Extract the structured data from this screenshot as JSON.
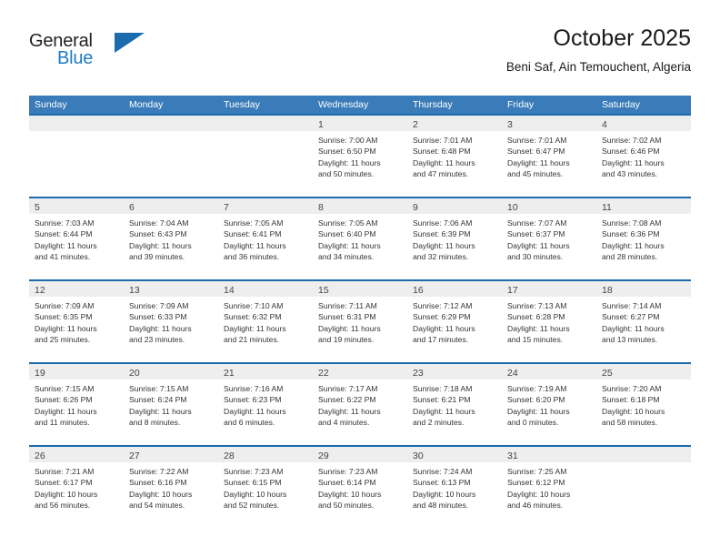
{
  "logo": {
    "word_one": "General",
    "word_two": "Blue",
    "triangle_icon": "triangle-icon",
    "accent_color": "#1a6cae"
  },
  "header": {
    "title": "October 2025",
    "subtitle": "Beni Saf, Ain Temouchent, Algeria"
  },
  "calendar": {
    "header_bg": "#3a7cba",
    "row_border_color": "#1a6cae",
    "daynum_band_color": "#eeeeee",
    "weekdays": [
      "Sunday",
      "Monday",
      "Tuesday",
      "Wednesday",
      "Thursday",
      "Friday",
      "Saturday"
    ],
    "weeks": [
      [
        {
          "day": "",
          "lines": []
        },
        {
          "day": "",
          "lines": []
        },
        {
          "day": "",
          "lines": []
        },
        {
          "day": "1",
          "lines": [
            "Sunrise: 7:00 AM",
            "Sunset: 6:50 PM",
            "Daylight: 11 hours",
            "and 50 minutes."
          ]
        },
        {
          "day": "2",
          "lines": [
            "Sunrise: 7:01 AM",
            "Sunset: 6:48 PM",
            "Daylight: 11 hours",
            "and 47 minutes."
          ]
        },
        {
          "day": "3",
          "lines": [
            "Sunrise: 7:01 AM",
            "Sunset: 6:47 PM",
            "Daylight: 11 hours",
            "and 45 minutes."
          ]
        },
        {
          "day": "4",
          "lines": [
            "Sunrise: 7:02 AM",
            "Sunset: 6:46 PM",
            "Daylight: 11 hours",
            "and 43 minutes."
          ]
        }
      ],
      [
        {
          "day": "5",
          "lines": [
            "Sunrise: 7:03 AM",
            "Sunset: 6:44 PM",
            "Daylight: 11 hours",
            "and 41 minutes."
          ]
        },
        {
          "day": "6",
          "lines": [
            "Sunrise: 7:04 AM",
            "Sunset: 6:43 PM",
            "Daylight: 11 hours",
            "and 39 minutes."
          ]
        },
        {
          "day": "7",
          "lines": [
            "Sunrise: 7:05 AM",
            "Sunset: 6:41 PM",
            "Daylight: 11 hours",
            "and 36 minutes."
          ]
        },
        {
          "day": "8",
          "lines": [
            "Sunrise: 7:05 AM",
            "Sunset: 6:40 PM",
            "Daylight: 11 hours",
            "and 34 minutes."
          ]
        },
        {
          "day": "9",
          "lines": [
            "Sunrise: 7:06 AM",
            "Sunset: 6:39 PM",
            "Daylight: 11 hours",
            "and 32 minutes."
          ]
        },
        {
          "day": "10",
          "lines": [
            "Sunrise: 7:07 AM",
            "Sunset: 6:37 PM",
            "Daylight: 11 hours",
            "and 30 minutes."
          ]
        },
        {
          "day": "11",
          "lines": [
            "Sunrise: 7:08 AM",
            "Sunset: 6:36 PM",
            "Daylight: 11 hours",
            "and 28 minutes."
          ]
        }
      ],
      [
        {
          "day": "12",
          "lines": [
            "Sunrise: 7:09 AM",
            "Sunset: 6:35 PM",
            "Daylight: 11 hours",
            "and 25 minutes."
          ]
        },
        {
          "day": "13",
          "lines": [
            "Sunrise: 7:09 AM",
            "Sunset: 6:33 PM",
            "Daylight: 11 hours",
            "and 23 minutes."
          ]
        },
        {
          "day": "14",
          "lines": [
            "Sunrise: 7:10 AM",
            "Sunset: 6:32 PM",
            "Daylight: 11 hours",
            "and 21 minutes."
          ]
        },
        {
          "day": "15",
          "lines": [
            "Sunrise: 7:11 AM",
            "Sunset: 6:31 PM",
            "Daylight: 11 hours",
            "and 19 minutes."
          ]
        },
        {
          "day": "16",
          "lines": [
            "Sunrise: 7:12 AM",
            "Sunset: 6:29 PM",
            "Daylight: 11 hours",
            "and 17 minutes."
          ]
        },
        {
          "day": "17",
          "lines": [
            "Sunrise: 7:13 AM",
            "Sunset: 6:28 PM",
            "Daylight: 11 hours",
            "and 15 minutes."
          ]
        },
        {
          "day": "18",
          "lines": [
            "Sunrise: 7:14 AM",
            "Sunset: 6:27 PM",
            "Daylight: 11 hours",
            "and 13 minutes."
          ]
        }
      ],
      [
        {
          "day": "19",
          "lines": [
            "Sunrise: 7:15 AM",
            "Sunset: 6:26 PM",
            "Daylight: 11 hours",
            "and 11 minutes."
          ]
        },
        {
          "day": "20",
          "lines": [
            "Sunrise: 7:15 AM",
            "Sunset: 6:24 PM",
            "Daylight: 11 hours",
            "and 8 minutes."
          ]
        },
        {
          "day": "21",
          "lines": [
            "Sunrise: 7:16 AM",
            "Sunset: 6:23 PM",
            "Daylight: 11 hours",
            "and 6 minutes."
          ]
        },
        {
          "day": "22",
          "lines": [
            "Sunrise: 7:17 AM",
            "Sunset: 6:22 PM",
            "Daylight: 11 hours",
            "and 4 minutes."
          ]
        },
        {
          "day": "23",
          "lines": [
            "Sunrise: 7:18 AM",
            "Sunset: 6:21 PM",
            "Daylight: 11 hours",
            "and 2 minutes."
          ]
        },
        {
          "day": "24",
          "lines": [
            "Sunrise: 7:19 AM",
            "Sunset: 6:20 PM",
            "Daylight: 11 hours",
            "and 0 minutes."
          ]
        },
        {
          "day": "25",
          "lines": [
            "Sunrise: 7:20 AM",
            "Sunset: 6:18 PM",
            "Daylight: 10 hours",
            "and 58 minutes."
          ]
        }
      ],
      [
        {
          "day": "26",
          "lines": [
            "Sunrise: 7:21 AM",
            "Sunset: 6:17 PM",
            "Daylight: 10 hours",
            "and 56 minutes."
          ]
        },
        {
          "day": "27",
          "lines": [
            "Sunrise: 7:22 AM",
            "Sunset: 6:16 PM",
            "Daylight: 10 hours",
            "and 54 minutes."
          ]
        },
        {
          "day": "28",
          "lines": [
            "Sunrise: 7:23 AM",
            "Sunset: 6:15 PM",
            "Daylight: 10 hours",
            "and 52 minutes."
          ]
        },
        {
          "day": "29",
          "lines": [
            "Sunrise: 7:23 AM",
            "Sunset: 6:14 PM",
            "Daylight: 10 hours",
            "and 50 minutes."
          ]
        },
        {
          "day": "30",
          "lines": [
            "Sunrise: 7:24 AM",
            "Sunset: 6:13 PM",
            "Daylight: 10 hours",
            "and 48 minutes."
          ]
        },
        {
          "day": "31",
          "lines": [
            "Sunrise: 7:25 AM",
            "Sunset: 6:12 PM",
            "Daylight: 10 hours",
            "and 46 minutes."
          ]
        },
        {
          "day": "",
          "lines": []
        }
      ]
    ]
  }
}
